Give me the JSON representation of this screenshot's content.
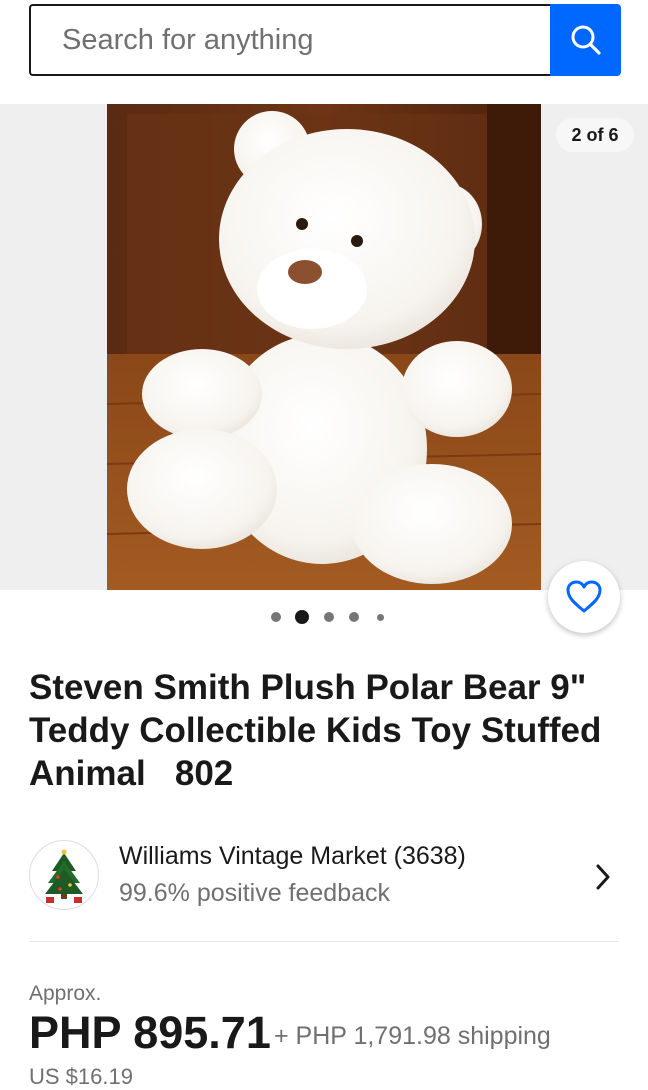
{
  "search": {
    "placeholder": "Search for anything"
  },
  "gallery": {
    "counter": "2 of 6",
    "dot_count": 5,
    "active_dot": 1
  },
  "listing": {
    "title": "Steven Smith Plush Polar Bear 9\" Teddy Collectible Kids Toy Stuffed Animal   802"
  },
  "seller": {
    "name": "Williams Vintage Market (3638)",
    "feedback": "99.6% positive feedback"
  },
  "price": {
    "approx_label": "Approx.",
    "amount": "PHP 895.71",
    "shipping": "+ PHP 1,791.98 shipping",
    "usd": "US $16.19"
  },
  "icons": {
    "search": "search-icon",
    "favorite": "heart-icon",
    "seller_avatar": "christmas-tree-icon",
    "next": "chevron-right-icon"
  },
  "colors": {
    "accent": "#0068ff",
    "text": "#191919",
    "muted": "#707070"
  }
}
